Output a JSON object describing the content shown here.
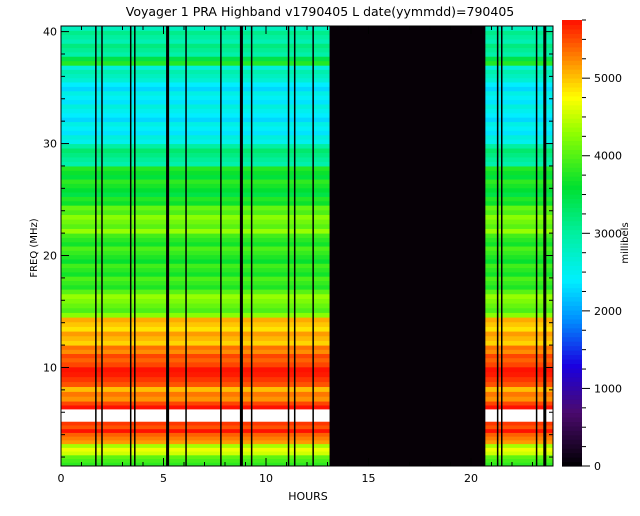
{
  "chart_data": {
    "type": "heatmap",
    "title": "Voyager 1  PRA Highband v1790405 L    date(yymmdd)=790405",
    "xlabel": "HOURS",
    "ylabel": "FREQ (MHz)",
    "colorbar_label": "millibels",
    "xlim": [
      0,
      24
    ],
    "ylim": [
      1.2,
      40.5
    ],
    "xticks": [
      "0",
      "5",
      "10",
      "15",
      "20"
    ],
    "yticks": [
      "10",
      "20",
      "30",
      "40"
    ],
    "colorbar_range": [
      0,
      5750
    ],
    "colorbar_ticks": [
      "0",
      "1000",
      "2000",
      "3000",
      "4000",
      "5000"
    ],
    "frequency_profile": [
      {
        "f": [
          1.2,
          2.2
        ],
        "v": 4000
      },
      {
        "f": [
          2.2,
          3.2
        ],
        "v": 4500
      },
      {
        "f": [
          3.2,
          4.2
        ],
        "v": 5300
      },
      {
        "f": [
          4.2,
          5.2
        ],
        "v": 5650
      },
      {
        "f": [
          5.2,
          6.3
        ],
        "v": null
      },
      {
        "f": [
          6.3,
          7.0
        ],
        "v": 5650
      },
      {
        "f": [
          7.0,
          8.3
        ],
        "v": 5200
      },
      {
        "f": [
          8.3,
          10.5
        ],
        "v": 5650
      },
      {
        "f": [
          10.5,
          12.0
        ],
        "v": 5350
      },
      {
        "f": [
          12.0,
          14.5
        ],
        "v": 5050
      },
      {
        "f": [
          14.5,
          17.0
        ],
        "v": 4150
      },
      {
        "f": [
          17.0,
          22.0
        ],
        "v": 3800
      },
      {
        "f": [
          22.0,
          24.5
        ],
        "v": 4150
      },
      {
        "f": [
          24.5,
          28.0
        ],
        "v": 3650
      },
      {
        "f": [
          28.0,
          30.0
        ],
        "v": 3100
      },
      {
        "f": [
          30.0,
          35.5
        ],
        "v": 2450
      },
      {
        "f": [
          35.5,
          37.0
        ],
        "v": 2800
      },
      {
        "f": [
          37.0,
          37.8
        ],
        "v": 3650
      },
      {
        "f": [
          37.8,
          40.5
        ],
        "v": 3000
      }
    ],
    "data_gap_hours": [
      13.1,
      20.7
    ],
    "dropout_hours": [
      1.7,
      2.0,
      3.4,
      3.6,
      5.2,
      6.1,
      7.8,
      8.8,
      9.3,
      11.1,
      11.4,
      12.3,
      21.3,
      21.5,
      23.2,
      23.6
    ],
    "colormap": [
      {
        "v": 0,
        "c": "#000000"
      },
      {
        "v": 700,
        "c": "#4b0a6e"
      },
      {
        "v": 1300,
        "c": "#1a00e0"
      },
      {
        "v": 1900,
        "c": "#0090ff"
      },
      {
        "v": 2400,
        "c": "#00f0ff"
      },
      {
        "v": 3000,
        "c": "#00f0a0"
      },
      {
        "v": 3600,
        "c": "#00e030"
      },
      {
        "v": 4300,
        "c": "#90ff00"
      },
      {
        "v": 4750,
        "c": "#ffff00"
      },
      {
        "v": 5150,
        "c": "#ffa000"
      },
      {
        "v": 5750,
        "c": "#ff1000"
      }
    ]
  }
}
